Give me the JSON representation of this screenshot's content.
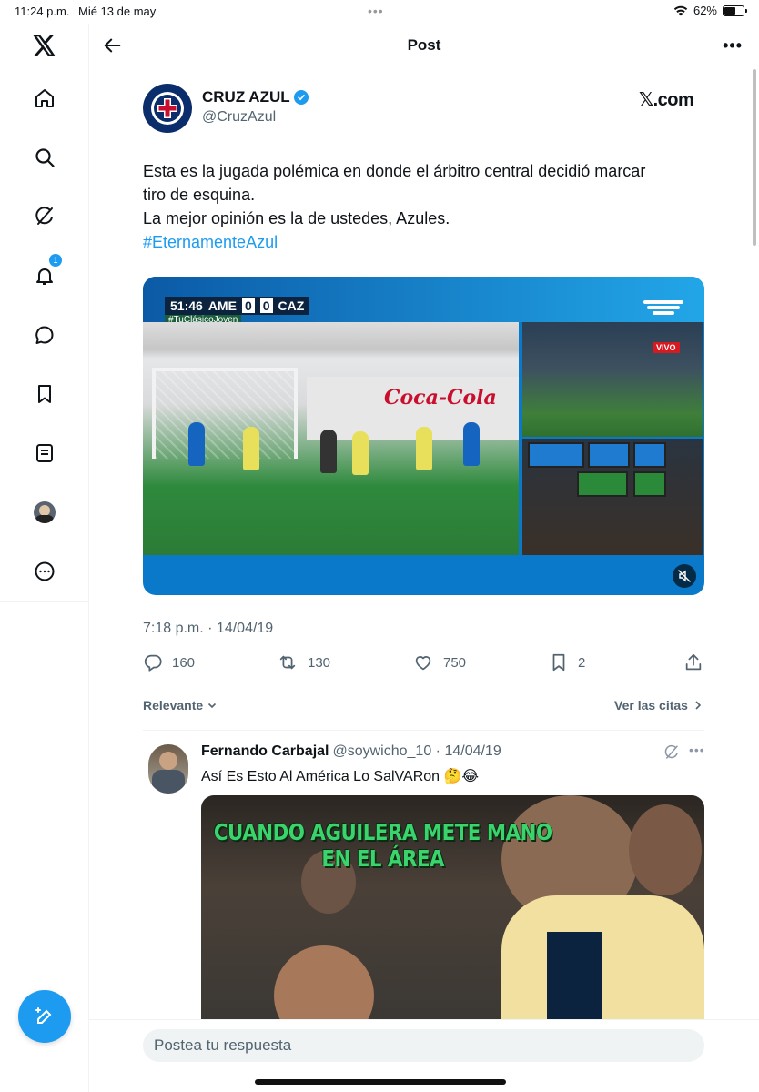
{
  "status_bar": {
    "time": "11:24 p.m.",
    "date": "Mié 13 de may",
    "battery": "62%",
    "battery_level": 0.62
  },
  "sidebar": {
    "items": [
      {
        "icon": "x-logo-icon"
      },
      {
        "icon": "home-icon"
      },
      {
        "icon": "search-icon"
      },
      {
        "icon": "grok-icon"
      },
      {
        "icon": "bell-icon",
        "badge": "1"
      },
      {
        "icon": "messages-icon"
      },
      {
        "icon": "bookmark-icon"
      },
      {
        "icon": "lists-icon"
      },
      {
        "icon": "profile-avatar"
      },
      {
        "icon": "more-circle-icon"
      }
    ],
    "compose_icon": "compose-icon"
  },
  "header": {
    "title": "Post"
  },
  "tweet": {
    "author_name": "CRUZ AZUL",
    "author_handle": "@CruzAzul",
    "source": "𝕏.com",
    "text_lines": [
      "Esta es la jugada polémica en donde el árbitro central decidió marcar",
      "tiro de esquina.",
      "La mejor opinión es la de ustedes, Azules."
    ],
    "hashtag": "#EternamenteAzul",
    "media": {
      "clock": "51:46",
      "home": "AME",
      "home_score": "0",
      "away_score": "0",
      "away": "CAZ",
      "tv_hashtag": "#TuClásicoJoven",
      "live_badge": "VIVO",
      "ad_text": "Coca-Cola"
    },
    "timestamp": "7:18 p.m. · 14/04/19",
    "stats": {
      "replies": "160",
      "reposts": "130",
      "likes": "750",
      "bookmarks": "2"
    }
  },
  "replies_section": {
    "sort_label": "Relevante",
    "quotes_label": "Ver las citas"
  },
  "reply": {
    "name": "Fernando Carbajal",
    "handle_date": "@soywicho_10 · 14/04/19",
    "text": "Así Es Esto Al América Lo SalVARon 🤔😂",
    "meme_caption": "CUANDO AGUILERA METE MANO EN EL ÁREA"
  },
  "reply_bar": {
    "placeholder": "Postea tu respuesta"
  },
  "colors": {
    "accent": "#1d9bf0",
    "text": "#0f1419",
    "secondary": "#536471",
    "border": "#eff3f4"
  }
}
